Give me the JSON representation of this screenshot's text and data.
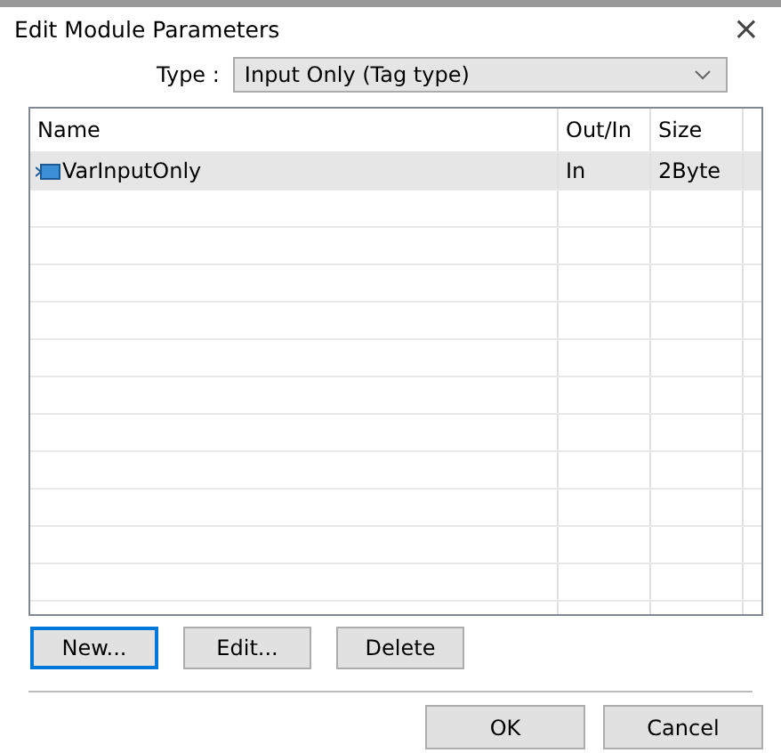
{
  "window": {
    "title": "Edit Module Parameters",
    "close": "×"
  },
  "type_field": {
    "label": "Type :",
    "value": "Input Only (Tag type)"
  },
  "table": {
    "columns": [
      "Name",
      "Out/In",
      "Size"
    ],
    "rows": [
      {
        "name": "VarInputOnly",
        "out_in": "In",
        "size": "2Byte",
        "selected": true
      }
    ]
  },
  "list_buttons": [
    {
      "label": "New...",
      "focused": true
    },
    {
      "label": "Edit...",
      "focused": false
    },
    {
      "label": "Delete",
      "focused": false
    }
  ],
  "dialog_buttons": [
    "OK",
    "Cancel"
  ]
}
